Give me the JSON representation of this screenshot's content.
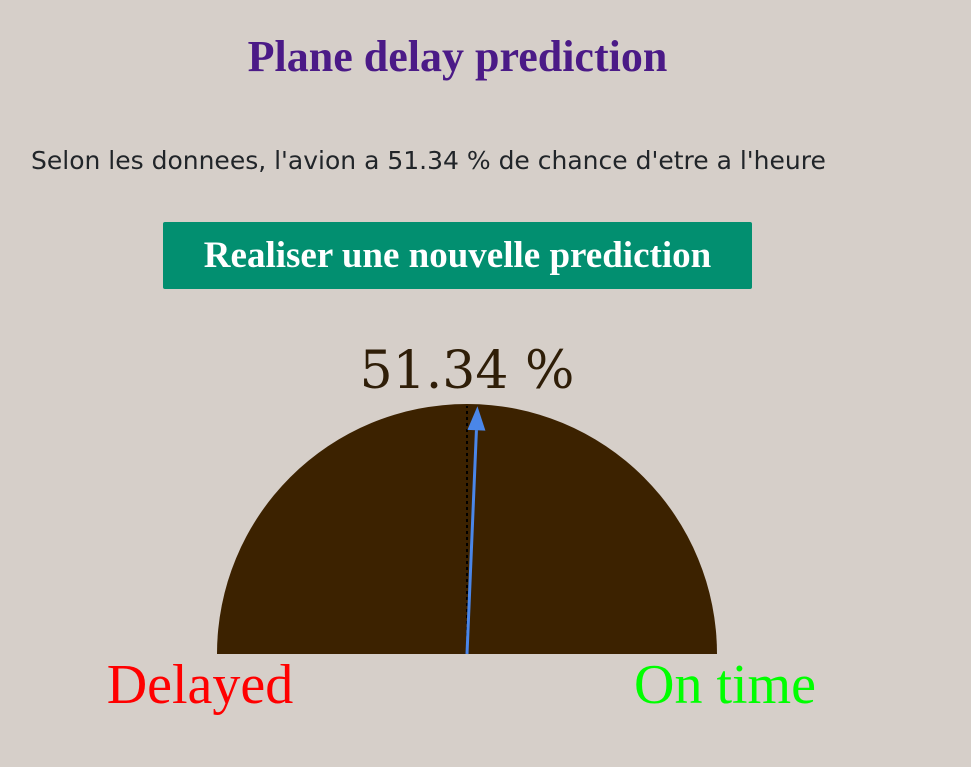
{
  "page": {
    "title": "Plane delay prediction",
    "result_text": "Selon les donnees, l'avion a 51.34 % de chance d'etre a l'heure",
    "new_prediction_button": "Realiser une nouvelle prediction"
  },
  "gauge": {
    "value_percent": 51.34,
    "value_label": "51.34 %",
    "left_label": "Delayed",
    "right_label": "On time",
    "colors": {
      "background": "#d6cfc9",
      "title": "#4b1a87",
      "button": "#028f70",
      "gauge_fill": "#3c2200",
      "needle": "#4a86e8",
      "delayed": "#ff0000",
      "on_time": "#00ff00"
    }
  }
}
